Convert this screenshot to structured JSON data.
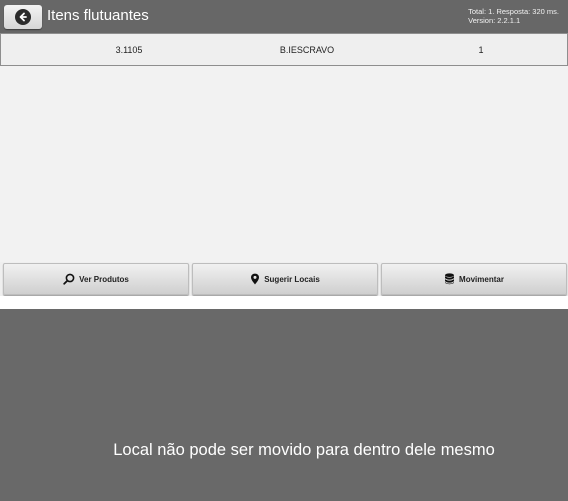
{
  "header": {
    "title": "Itens flutuantes",
    "info_line1": "Total: 1. Resposta: 320 ms.",
    "info_line2": "Version: 2.2.1.1",
    "back_icon": "arrow-left-icon"
  },
  "table": {
    "rows": [
      {
        "code": "3.1105",
        "location": "B.IESCRAVO",
        "quantity": "1"
      }
    ]
  },
  "toolbar": {
    "ver_produtos": "Ver Produtos",
    "sugerir_locais": "Sugerir Locais",
    "movimentar": "Movimentar",
    "icons": [
      "search-icon",
      "map-pin-icon",
      "database-icon"
    ]
  },
  "toast": {
    "message": "Local não pode ser movido para dentro dele mesmo"
  },
  "colors": {
    "header_bg": "#676767",
    "content_bg": "#f2f2f2",
    "toast_bg": "#696969"
  }
}
